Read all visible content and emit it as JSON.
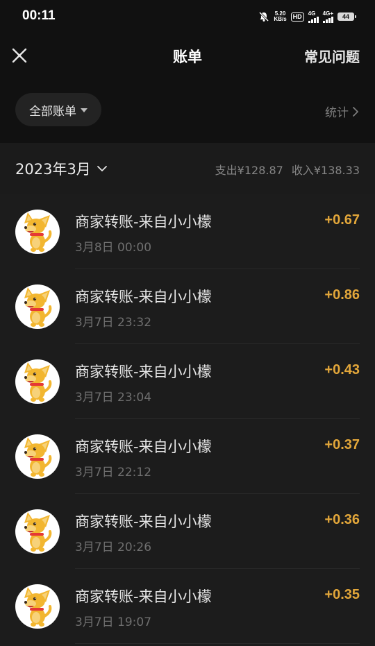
{
  "status_bar": {
    "time": "00:11",
    "net_speed_value": "5.20",
    "net_speed_unit": "KB/s",
    "hd_label": "HD",
    "net1_label": "4G",
    "net2_label": "4G+",
    "battery": "44"
  },
  "header": {
    "title": "账单",
    "faq_label": "常见问题"
  },
  "filter": {
    "label": "全部账单",
    "stats_label": "统计"
  },
  "month_bar": {
    "month": "2023年3月",
    "expense": "支出¥128.87",
    "income": "收入¥138.33"
  },
  "transactions": [
    {
      "title": "商家转账-来自小小檬",
      "time": "3月8日 00:00",
      "amount": "+0.67"
    },
    {
      "title": "商家转账-来自小小檬",
      "time": "3月7日 23:32",
      "amount": "+0.86"
    },
    {
      "title": "商家转账-来自小小檬",
      "time": "3月7日 23:04",
      "amount": "+0.43"
    },
    {
      "title": "商家转账-来自小小檬",
      "time": "3月7日 22:12",
      "amount": "+0.37"
    },
    {
      "title": "商家转账-来自小小檬",
      "time": "3月7日 20:26",
      "amount": "+0.36"
    },
    {
      "title": "商家转账-来自小小檬",
      "time": "3月7日 19:07",
      "amount": "+0.35"
    }
  ],
  "colors": {
    "background": "#111111",
    "list_background": "#1c1c1c",
    "amount": "#e3a73a",
    "dog": "#f2b630",
    "collar": "#e53935"
  },
  "icons": {
    "close": "close-icon",
    "filter_caret": "caret-down-icon",
    "stats_chevron": "chevron-right-icon",
    "month_chevron": "chevron-down-icon",
    "avatar": "dog-avatar-icon"
  }
}
